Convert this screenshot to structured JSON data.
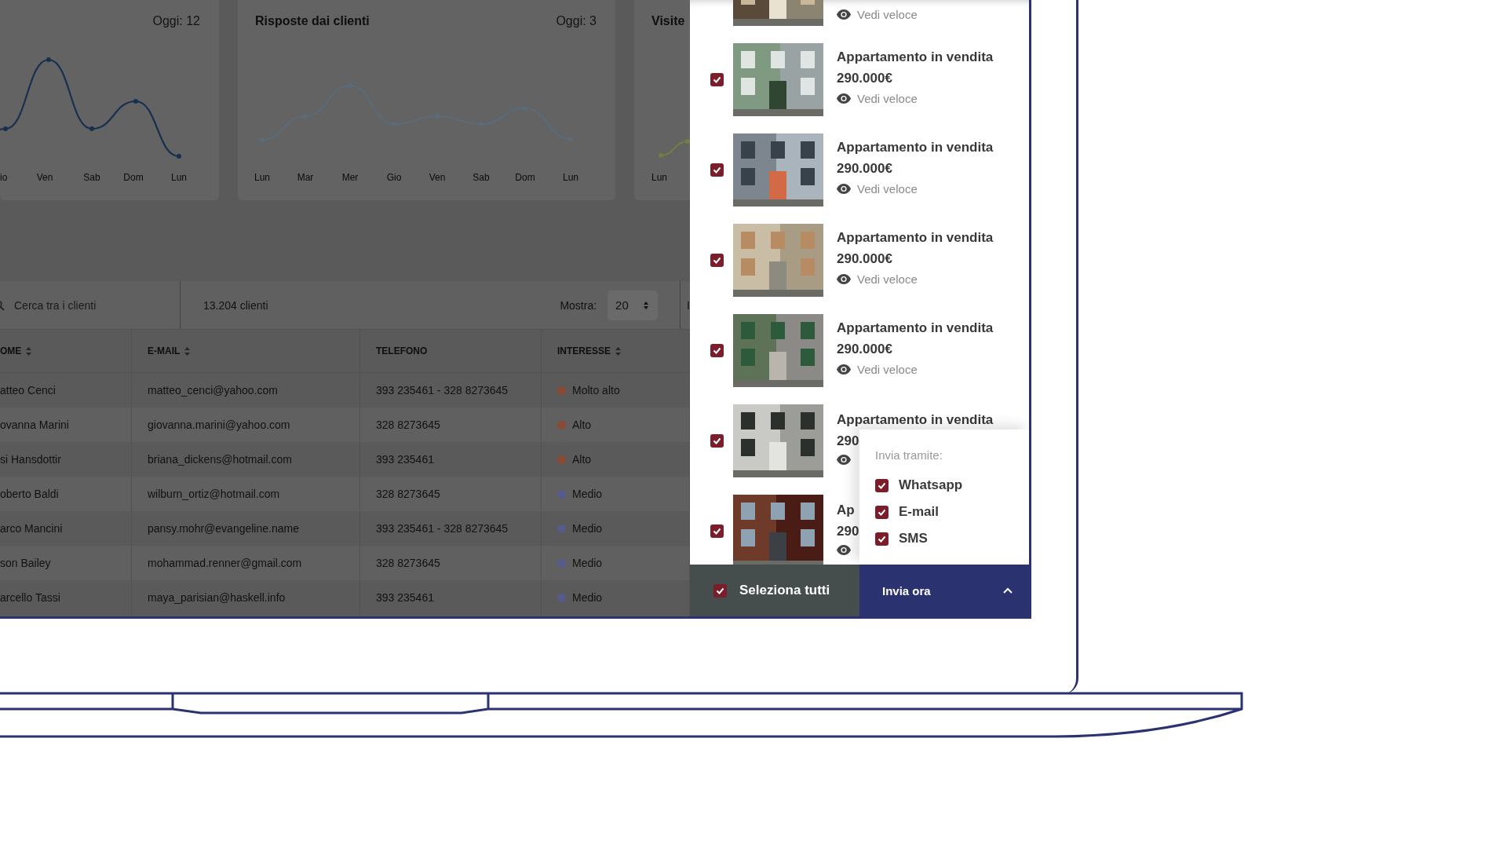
{
  "charts": [
    {
      "today": "Oggi: 12",
      "x_labels": [
        "io",
        "Ven",
        "Sab",
        "Dom",
        "Lun"
      ]
    },
    {
      "title": "Risposte dai clienti",
      "today": "Oggi: 3",
      "x_labels": [
        "Lun",
        "Mar",
        "Mer",
        "Gio",
        "Ven",
        "Sab",
        "Dom",
        "Lun"
      ]
    },
    {
      "title": "Visite",
      "x_labels": [
        "Lun"
      ]
    }
  ],
  "toolbar": {
    "search_placeholder": "Cerca tra i clienti",
    "count": "13.204 clienti",
    "show_label": "Mostra:",
    "show_value": "20",
    "cut_label": "I"
  },
  "table": {
    "columns": [
      {
        "label": "OME",
        "sortable": true
      },
      {
        "label": "E-MAIL",
        "sortable": true
      },
      {
        "label": "TELEFONO",
        "sortable": false
      },
      {
        "label": "INTERESSE",
        "sortable": true
      }
    ],
    "rows": [
      {
        "name": "atteo Cenci",
        "email": "matteo_cenci@yahoo.com",
        "phone": "393 235461  -  328 8273645",
        "interest": "Molto alto",
        "color": "#8a4a33"
      },
      {
        "name": "ovanna Marini",
        "email": "giovanna.marini@yahoo.com",
        "phone": "328 8273645",
        "interest": "Alto",
        "color": "#8a4a33"
      },
      {
        "name": "si Hansdottir",
        "email": "briana_dickens@hotmail.com",
        "phone": "393 235461",
        "interest": "Alto",
        "color": "#8a4a33"
      },
      {
        "name": "oberto Baldi",
        "email": "wilburn_ortiz@hotmail.com",
        "phone": "328 8273645",
        "interest": "Medio",
        "color": "#575b8c"
      },
      {
        "name": "arco Mancini",
        "email": "pansy.mohr@evangeline.name",
        "phone": "393 235461  -  328 8273645",
        "interest": "Medio",
        "color": "#575b8c"
      },
      {
        "name": "son Bailey",
        "email": "mohammad.renner@gmail.com",
        "phone": "328 8273645",
        "interest": "Medio",
        "color": "#575b8c"
      },
      {
        "name": "arcello Tassi",
        "email": "maya_parisian@haskell.info",
        "phone": "393 235461",
        "interest": "Medio",
        "color": "#575b8c"
      }
    ]
  },
  "listings": [
    {
      "kind": "partial",
      "quick_view": "Vedi veloce"
    },
    {
      "kind": "full",
      "checked": true,
      "title": "Appartamento in vendita",
      "price": "290.000€",
      "quick_view": "Vedi veloce"
    },
    {
      "kind": "full",
      "checked": true,
      "title": "Appartamento in vendita",
      "price": "290.000€",
      "quick_view": "Vedi veloce"
    },
    {
      "kind": "full",
      "checked": true,
      "title": "Appartamento in vendita",
      "price": "290.000€",
      "quick_view": "Vedi veloce"
    },
    {
      "kind": "full",
      "checked": true,
      "title": "Appartamento in vendita",
      "price": "290.000€",
      "quick_view": "Vedi veloce"
    },
    {
      "kind": "full",
      "checked": true,
      "title": "Appartamento in vendita",
      "price": "290"
    },
    {
      "kind": "full",
      "checked": true,
      "title": "Ap",
      "price": "290"
    }
  ],
  "send_popup": {
    "label": "Invia tramite:",
    "channels": [
      {
        "label": "Whatsapp",
        "checked": true
      },
      {
        "label": "E-mail",
        "checked": true
      },
      {
        "label": "SMS",
        "checked": true
      }
    ]
  },
  "footer": {
    "select_all": {
      "label": "Seleziona tutti",
      "checked": true
    },
    "send_button": "Invia ora",
    "expanded": true
  }
}
